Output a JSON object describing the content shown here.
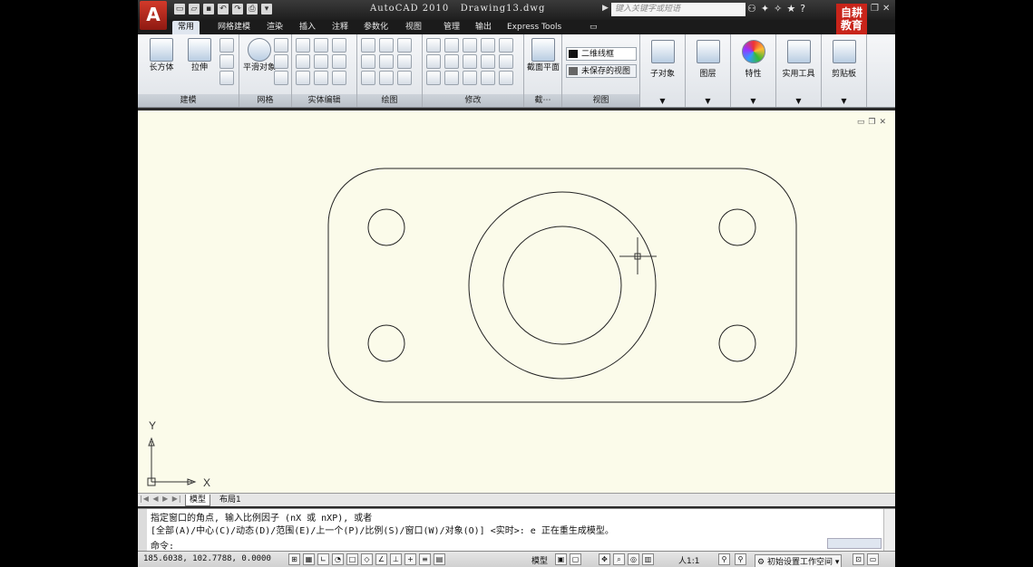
{
  "titlebar": {
    "app_logo": "A",
    "title": "AutoCAD 2010   Drawing13.dwg",
    "search_placeholder": "键入关键字或短语",
    "brand_text": "自耕教育"
  },
  "tabs": [
    "常用",
    "网格建模",
    "渲染",
    "插入",
    "注释",
    "参数化",
    "视图",
    "管理",
    "输出",
    "Express Tools"
  ],
  "active_tab": "常用",
  "ribbon": {
    "panels": {
      "modeling": "建模",
      "mesh": "网格",
      "solid_edit": "实体编辑",
      "draw": "绘图",
      "modify": "修改",
      "section": "截⋯",
      "view": "视图"
    },
    "buttons": {
      "box": "长方体",
      "extrude": "拉伸",
      "smooth_object": "平滑对象",
      "section_plane": "截面平面",
      "subobject": "子对象",
      "layers": "图层",
      "properties": "特性",
      "utilities": "实用工具",
      "clipboard": "剪贴板"
    },
    "visual_style": "二维线框",
    "saved_view": "未保存的视图"
  },
  "layout_tabs": [
    "模型",
    "布局1"
  ],
  "active_layout": "模型",
  "command": {
    "line1": "指定窗口的角点, 输入比例因子 (nX 或 nXP), 或者",
    "line2": "[全部(A)/中心(C)/动态(D)/范围(E)/上一个(P)/比例(S)/窗口(W)/对象(O)] <实时>: e 正在重生成模型。",
    "prompt": "命令:"
  },
  "status": {
    "coordinates": "185.6038, 102.7788, 0.0000",
    "model_label": "模型",
    "annotation_scale": "人1:1",
    "workspace": "初始设置工作空间"
  },
  "ucs": {
    "x_label": "X",
    "y_label": "Y"
  }
}
